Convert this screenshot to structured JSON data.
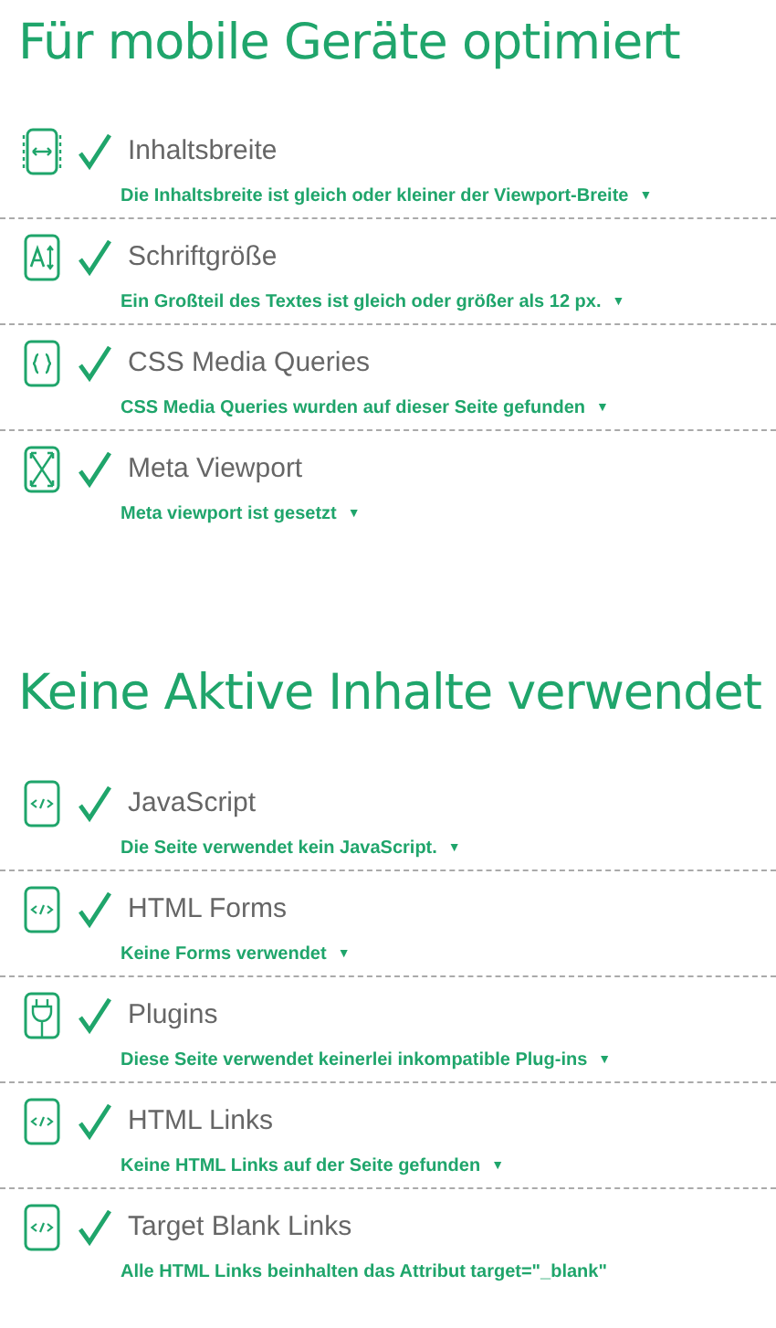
{
  "sections": [
    {
      "title": "Für mobile Geräte optimiert",
      "items": [
        {
          "kind": "width",
          "passed": true,
          "label": "Inhaltsbreite",
          "detail": "Die Inhaltsbreite ist gleich oder kleiner der Viewport-Breite",
          "toggle": "▼"
        },
        {
          "kind": "font",
          "passed": true,
          "label": "Schriftgröße",
          "detail": "Ein Großteil des Textes ist gleich oder größer als 12 px.",
          "toggle": "▼"
        },
        {
          "kind": "braces",
          "passed": true,
          "label": "CSS Media Queries",
          "detail": "CSS Media Queries wurden auf dieser Seite gefunden",
          "toggle": "▼"
        },
        {
          "kind": "viewport",
          "passed": true,
          "label": "Meta Viewport",
          "detail": "Meta viewport ist gesetzt",
          "toggle": "▼"
        }
      ]
    },
    {
      "title": "Keine Aktive Inhalte verwendet",
      "items": [
        {
          "kind": "code",
          "passed": true,
          "label": "JavaScript",
          "detail": "Die Seite verwendet kein JavaScript.",
          "toggle": "▼"
        },
        {
          "kind": "code",
          "passed": true,
          "label": "HTML Forms",
          "detail": "Keine Forms verwendet",
          "toggle": "▼"
        },
        {
          "kind": "plug",
          "passed": true,
          "label": "Plugins",
          "detail": "Diese Seite verwendet keinerlei inkompatible Plug-ins",
          "toggle": "▼"
        },
        {
          "kind": "code",
          "passed": true,
          "label": "HTML Links",
          "detail": "Keine HTML Links auf der Seite gefunden",
          "toggle": "▼"
        },
        {
          "kind": "code",
          "passed": true,
          "label": "Target Blank Links",
          "detail": "Alle HTML Links beinhalten das Attribut target=\"_blank\""
        }
      ]
    }
  ]
}
